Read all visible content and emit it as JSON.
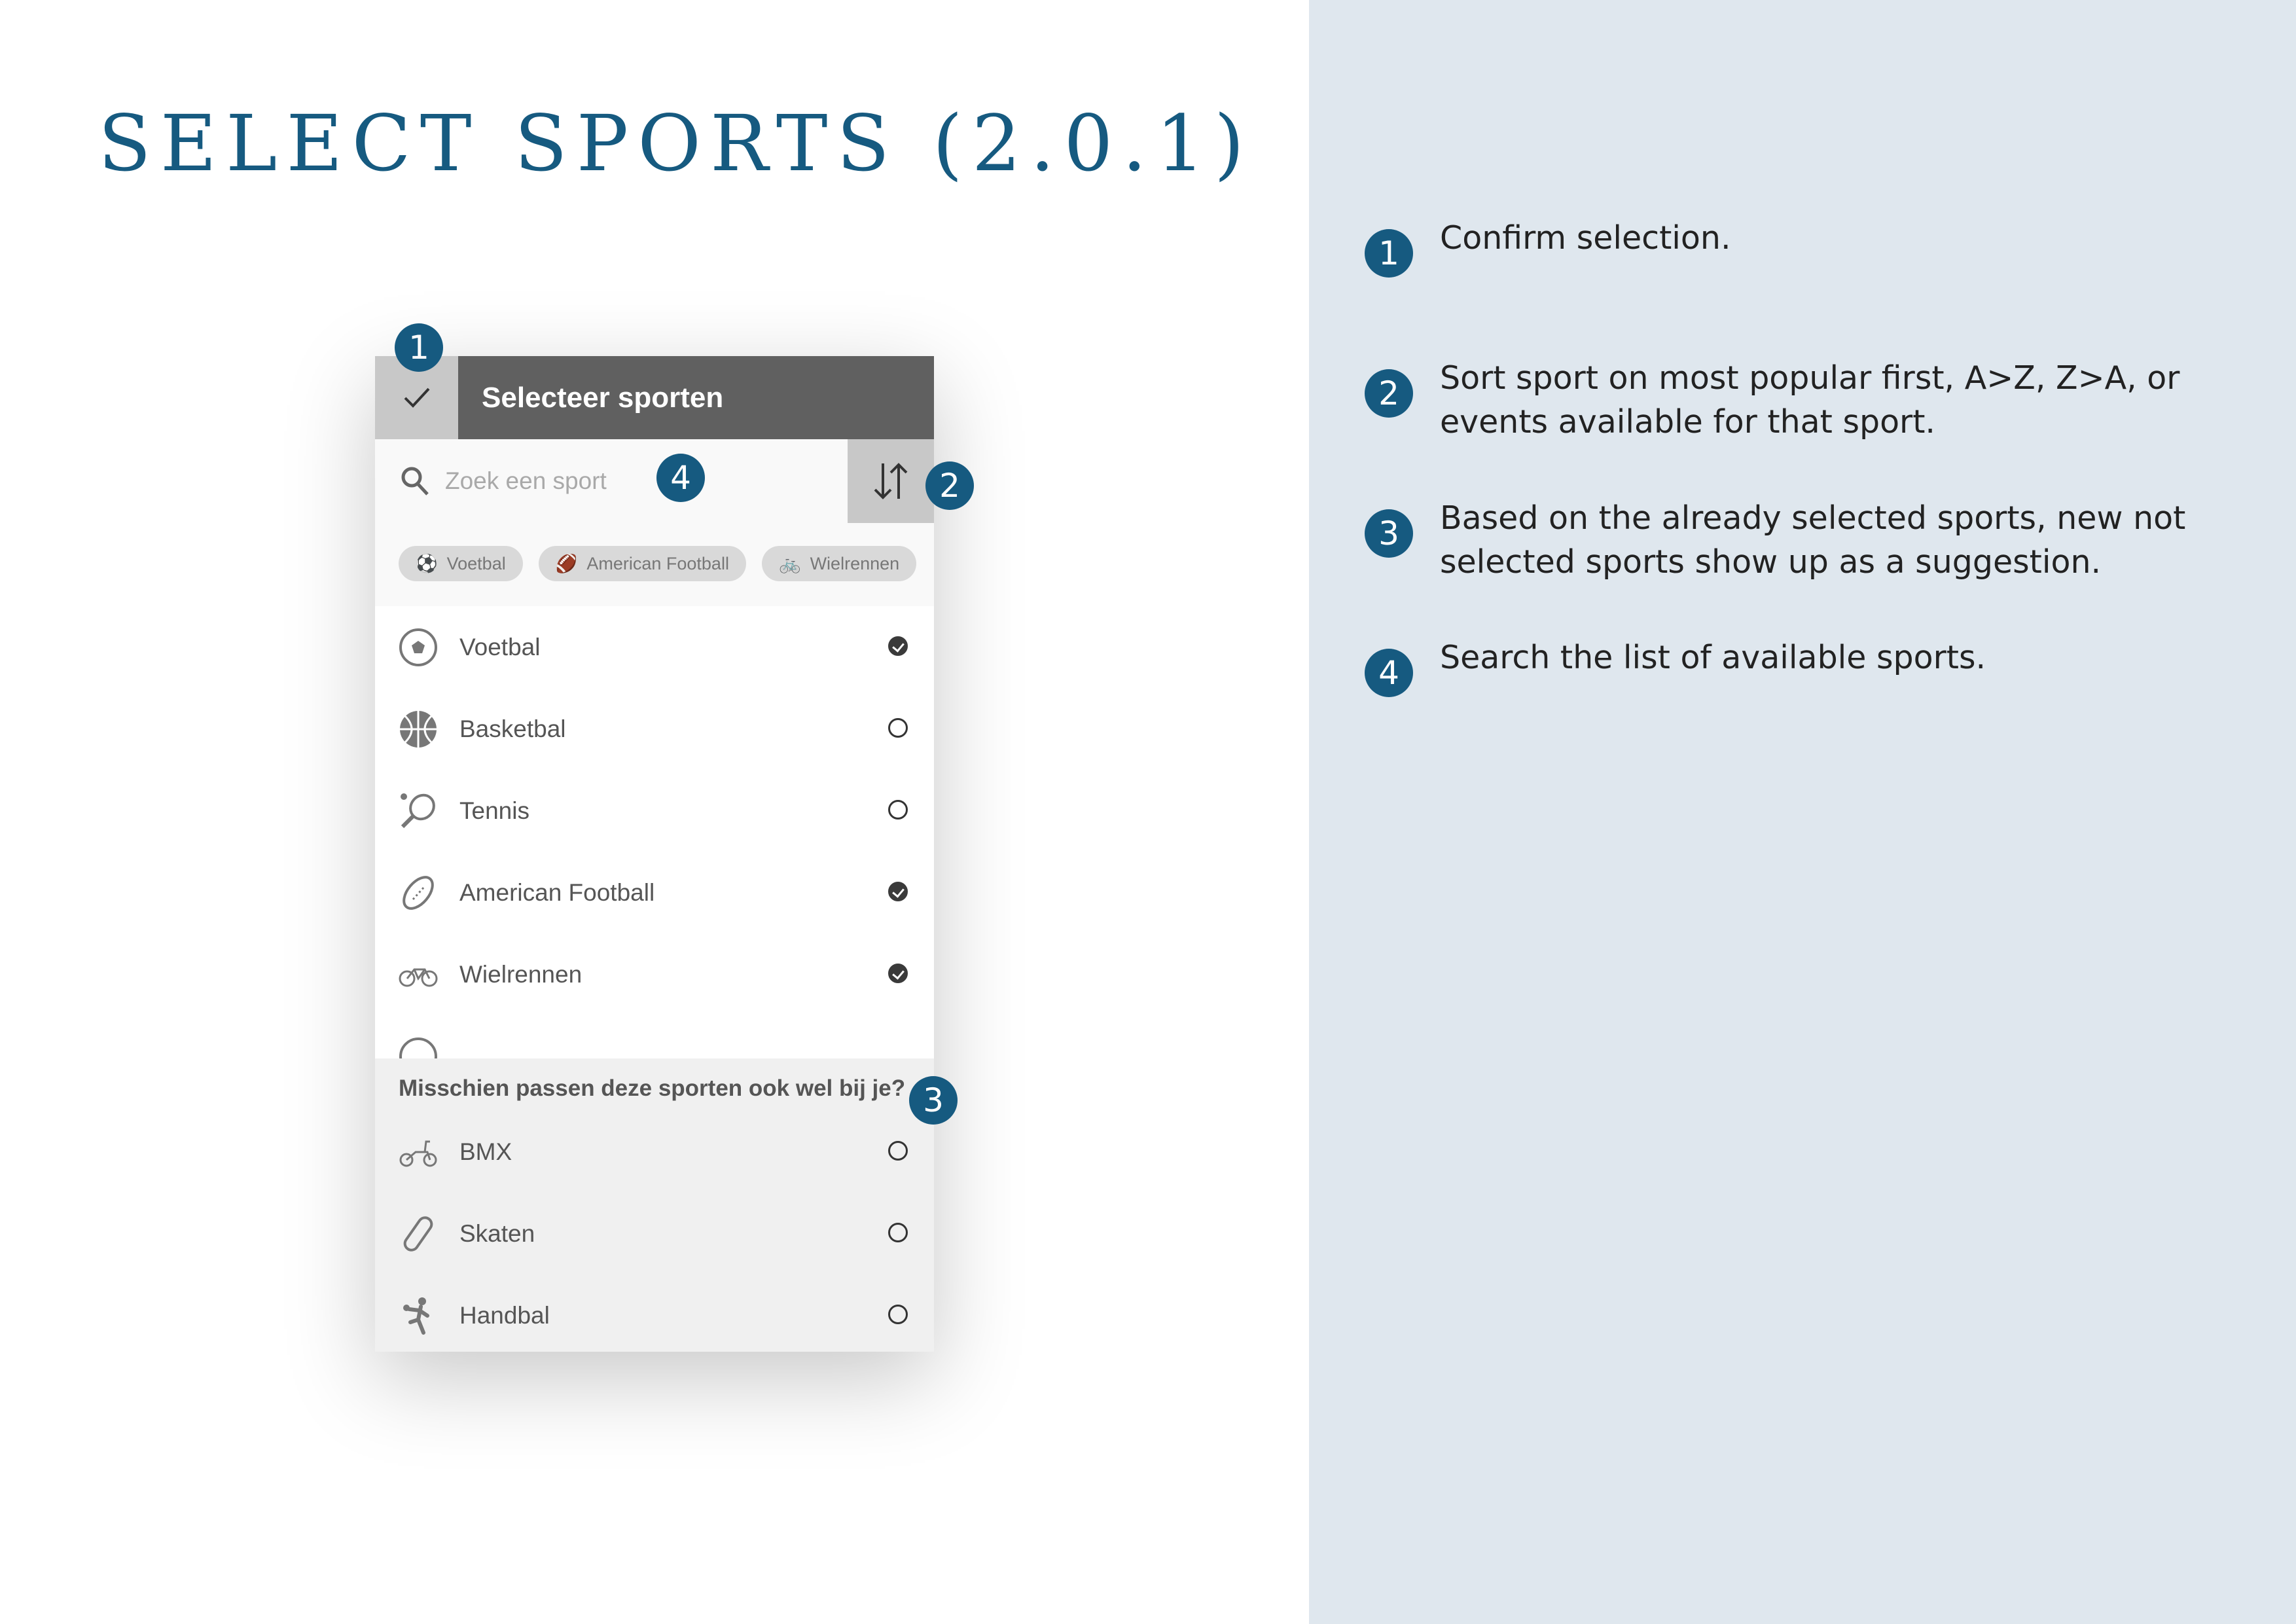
{
  "page": {
    "title": "SELECT SPORTS (2.0.1)"
  },
  "app": {
    "header_title": "Selecteer sporten",
    "confirm_icon": "check-icon",
    "search": {
      "placeholder": "Zoek een sport",
      "value": "",
      "icon": "search-icon"
    },
    "sort_icon": "sort-arrows-icon",
    "chips": [
      {
        "label": "Voetbal",
        "icon": "soccer-ball-icon"
      },
      {
        "label": "American Football",
        "icon": "american-football-icon"
      },
      {
        "label": "Wielrennen",
        "icon": "bicycle-icon"
      }
    ],
    "sports": [
      {
        "label": "Voetbal",
        "icon": "soccer-ball-icon",
        "selected": true
      },
      {
        "label": "Basketbal",
        "icon": "basketball-icon",
        "selected": false
      },
      {
        "label": "Tennis",
        "icon": "tennis-icon",
        "selected": false
      },
      {
        "label": "American Football",
        "icon": "american-football-icon",
        "selected": true
      },
      {
        "label": "Wielrennen",
        "icon": "bicycle-icon",
        "selected": true
      }
    ],
    "suggestions": {
      "title": "Misschien passen deze sporten ook wel bij je?",
      "items": [
        {
          "label": "BMX",
          "icon": "bmx-icon",
          "selected": false
        },
        {
          "label": "Skaten",
          "icon": "skateboard-icon",
          "selected": false
        },
        {
          "label": "Handbal",
          "icon": "handball-icon",
          "selected": false
        }
      ]
    }
  },
  "callouts": [
    "1",
    "2",
    "3",
    "4"
  ],
  "notes": [
    {
      "number": "1",
      "text": "Confirm selection."
    },
    {
      "number": "2",
      "text": "Sort sport on most popular first, A>Z, Z>A, or events available for that sport."
    },
    {
      "number": "3",
      "text": "Based on the already selected sports, new not selected sports show up as a suggestion."
    },
    {
      "number": "4",
      "text": "Search the list of available sports."
    }
  ],
  "colors": {
    "accent": "#165a80",
    "header": "#606060",
    "panel_bg": "#dfe7ee"
  }
}
